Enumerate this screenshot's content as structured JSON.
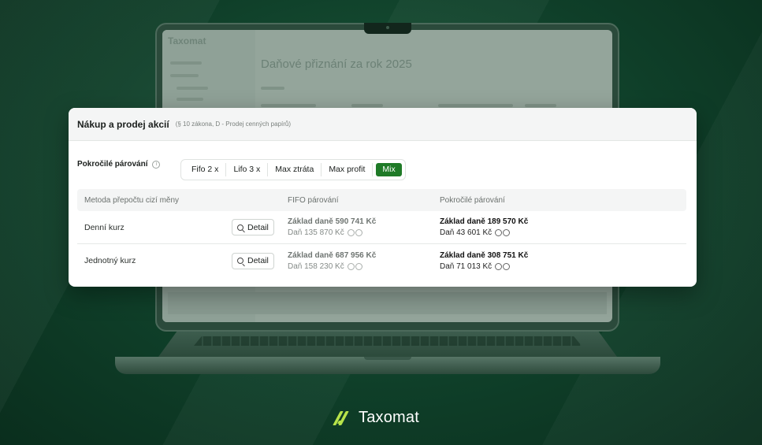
{
  "background": {
    "color": "#0d3a26"
  },
  "screen": {
    "logo": "Taxomat",
    "title": "Daňové přiznání za rok 2025"
  },
  "card": {
    "title": "Nákup a prodej akcií",
    "subtitle": "(§ 10 zákona, D - Prodej cenných papírů)"
  },
  "pairing": {
    "label": "Pokročilé párování",
    "info_icon": "info-icon",
    "options": [
      "Fifo 2 x",
      "Lifo 3 x",
      "Max ztráta",
      "Max profit",
      "Mix"
    ],
    "selected": "Mix",
    "accent": "#1f7a27"
  },
  "table": {
    "headers": [
      "Metoda přepočtu cizí měny",
      "FIFO párování",
      "Pokročilé párování"
    ],
    "rows": [
      {
        "method": "Denní kurz",
        "detail": "Detail",
        "fifo_base": "Základ daně 590 741 Kč",
        "fifo_tax": "Daň 135 870 Kč",
        "adv_base": "Základ daně 189 570 Kč",
        "adv_tax": "Daň 43 601 Kč"
      },
      {
        "method": "Jednotný kurz",
        "detail": "Detail",
        "fifo_base": "Základ daně 687 956 Kč",
        "fifo_tax": "Daň 158 230 Kč",
        "adv_base": "Základ daně 308 751 Kč",
        "adv_tax": "Daň 71 013 Kč"
      }
    ]
  },
  "brand": {
    "name": "Taxomat",
    "accent": "#b7e34a"
  }
}
